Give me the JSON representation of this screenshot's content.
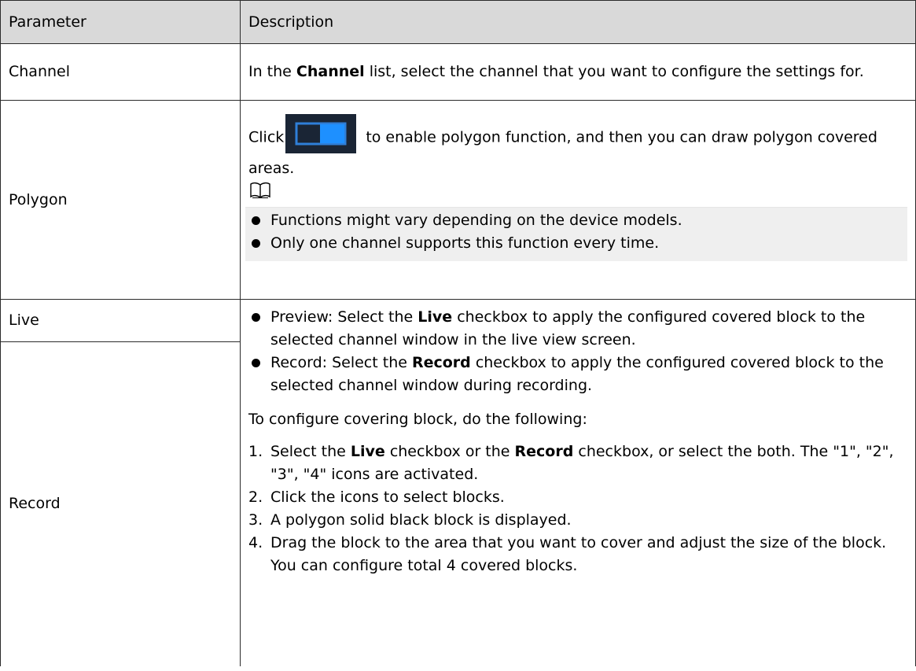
{
  "table": {
    "headers": [
      "Parameter",
      "Description"
    ],
    "rows": {
      "channel": {
        "param": "Channel",
        "desc_prefix": "In the ",
        "desc_bold": "Channel",
        "desc_suffix": " list, select the channel that you want to configure the settings for."
      },
      "polygon": {
        "param": "Polygon",
        "click_text": "Click",
        "desc_after_icon": " to enable polygon function, and then you can draw polygon covered areas.",
        "notes": [
          "Functions might vary depending on the device models.",
          "Only one channel supports this function every time."
        ]
      },
      "live": {
        "param": "Live"
      },
      "record": {
        "param": "Record",
        "bullets": [
          {
            "prefix": "Preview: Select the ",
            "bold": "Live",
            "suffix": "  checkbox to apply the configured covered block to the selected channel window in the live view screen."
          },
          {
            "prefix": "Record: Select the ",
            "bold": "Record",
            "suffix": "  checkbox to apply the configured covered block to the selected channel window during recording."
          }
        ],
        "intro": "To configure covering block, do the following:",
        "steps": [
          {
            "num": "1.",
            "prefix": "Select the ",
            "bold1": "Live",
            "middle": "  checkbox or the ",
            "bold2": "Record",
            "suffix": " checkbox, or select the both. The \"1\", \"2\", \"3\", \"4\" icons are activated."
          },
          {
            "num": "2.",
            "text": "Click the icons to select blocks."
          },
          {
            "num": "3.",
            "text": "A polygon solid black block is displayed."
          },
          {
            "num": "4.",
            "text": "Drag the block to the area that you want to cover and adjust the size of the block. You can configure total 4 covered blocks."
          }
        ]
      }
    }
  },
  "icons": {
    "toggle": "toggle-switch-icon",
    "note": "book-note-icon"
  },
  "colors": {
    "header_bg": "#d9d9d9",
    "note_bg": "#efefef",
    "toggle_bg": "#1a2535",
    "toggle_accent": "#1e90ff"
  }
}
